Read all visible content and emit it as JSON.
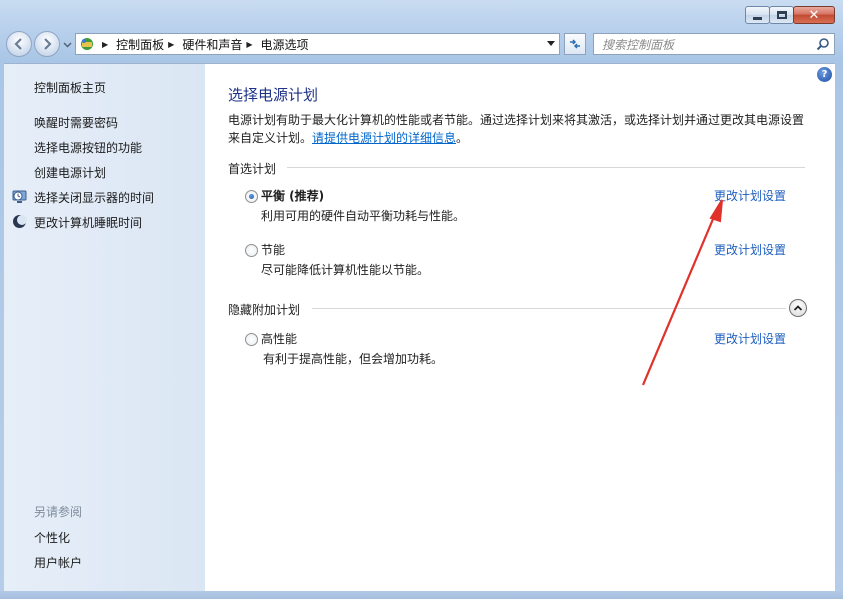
{
  "window": {
    "caption_buttons": [
      "minimize",
      "maximize",
      "close"
    ],
    "close_glyph": "✕"
  },
  "nav": {
    "breadcrumbs": [
      "控制面板",
      "硬件和声音",
      "电源选项"
    ],
    "search_placeholder": "搜索控制面板"
  },
  "sidebar": {
    "home_link": "控制面板主页",
    "links": [
      {
        "label": "唤醒时需要密码",
        "icon": ""
      },
      {
        "label": "选择电源按钮的功能",
        "icon": ""
      },
      {
        "label": "创建电源计划",
        "icon": ""
      },
      {
        "label": "选择关闭显示器的时间",
        "icon": "monitor-clock-icon"
      },
      {
        "label": "更改计算机睡眠时间",
        "icon": "moon-icon"
      }
    ],
    "see_also_label": "另请参阅",
    "see_also_links": [
      "个性化",
      "用户帐户"
    ]
  },
  "main": {
    "title": "选择电源计划",
    "description": "电源计划有助于最大化计算机的性能或者节能。通过选择计划来将其激活，或选择计划并通过更改其电源设置来自定义计划。",
    "description_link": "请提供电源计划的详细信息",
    "description_end": "。",
    "preferred_header": "首选计划",
    "hidden_header": "隐藏附加计划",
    "change_link_label": "更改计划设置",
    "plans": [
      {
        "name": "平衡 (推荐)",
        "desc": "利用可用的硬件自动平衡功耗与性能。",
        "checked": true
      },
      {
        "name": "节能",
        "desc": "尽可能降低计算机性能以节能。",
        "checked": false
      },
      {
        "name": "高性能",
        "desc": "有利于提高性能，但会增加功耗。",
        "checked": false
      }
    ],
    "help_glyph": "?"
  },
  "colors": {
    "title_blue": "#1e3287",
    "link_blue": "#1f5fbf",
    "annotation_arrow": "#e0322a"
  }
}
